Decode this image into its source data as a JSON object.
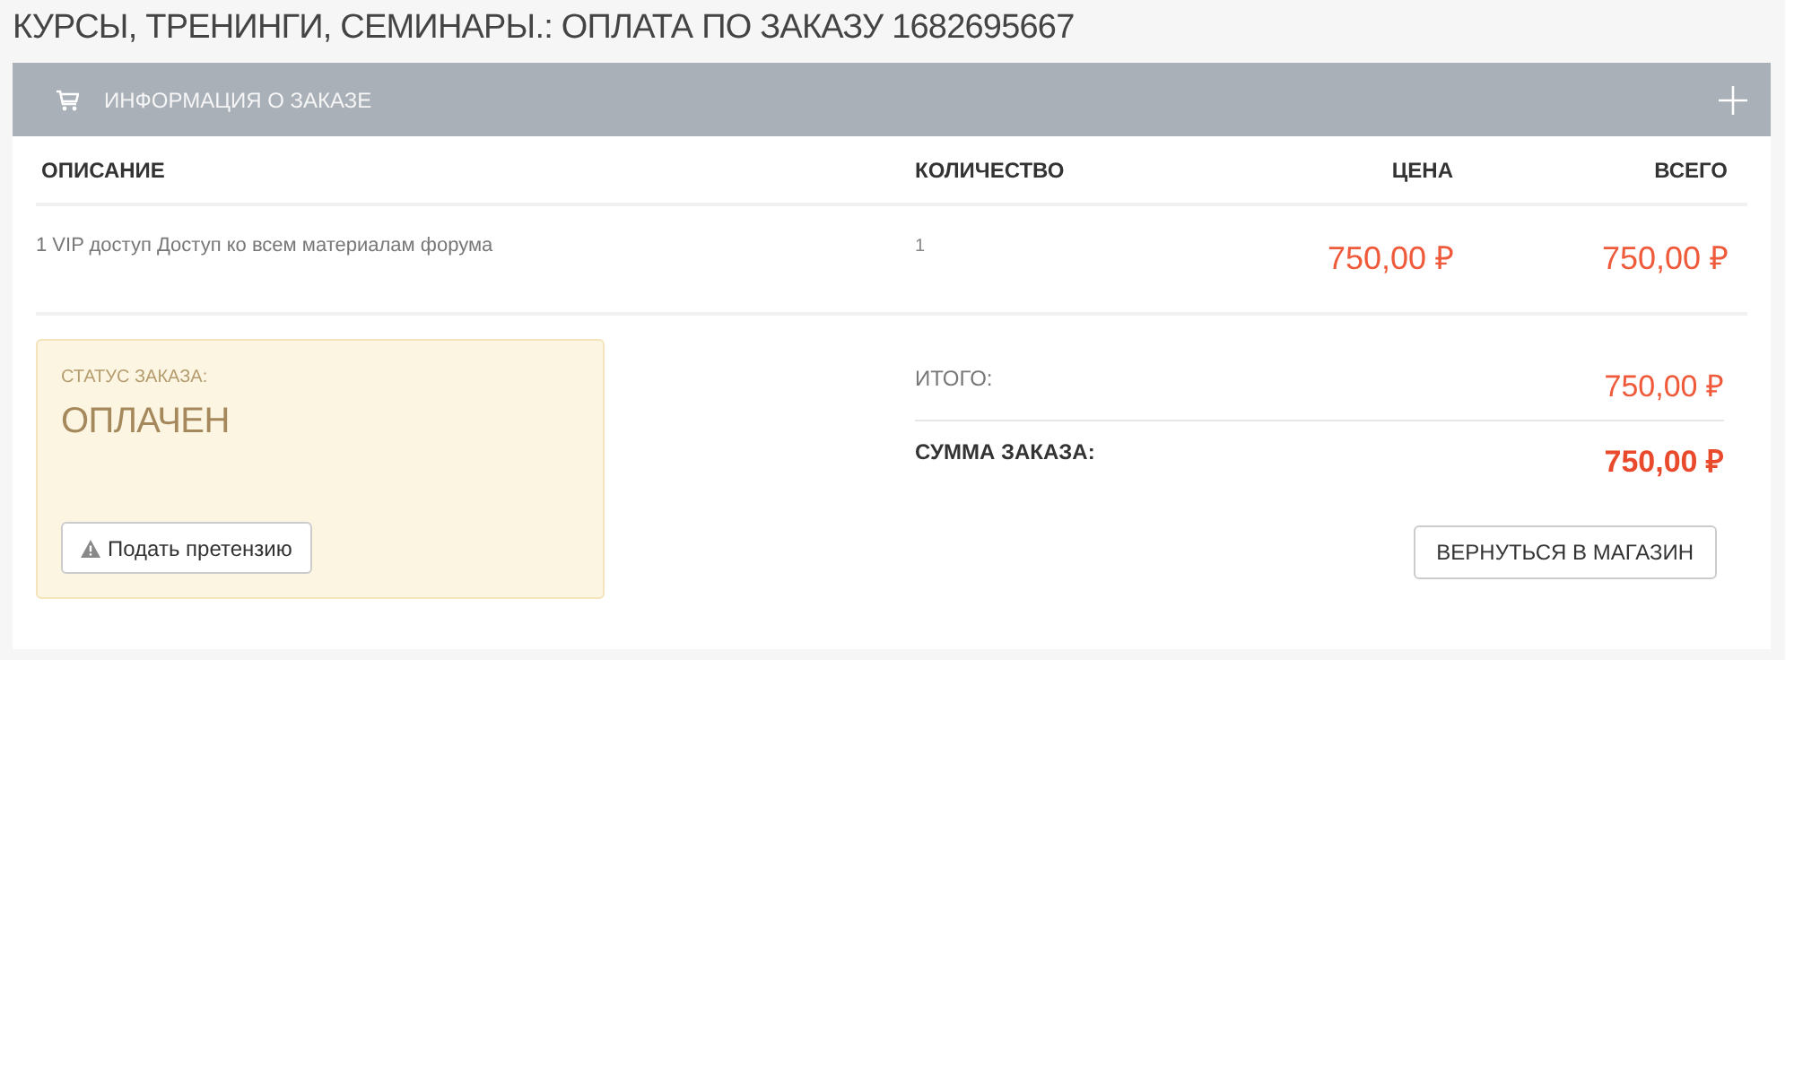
{
  "page_title": "КУРСЫ, ТРЕНИНГИ, СЕМИНАРЫ.: ОПЛАТА ПО ЗАКАЗУ 1682695667",
  "panel": {
    "title": "ИНФОРМАЦИЯ О ЗАКАЗЕ"
  },
  "table": {
    "columns": [
      "ОПИСАНИЕ",
      "КОЛИЧЕСТВО",
      "ЦЕНА",
      "ВСЕГО"
    ],
    "rows": [
      {
        "description": "1 VIP доступ Доступ ко всем материалам форума",
        "quantity": "1",
        "price": "750,00 ₽",
        "total": "750,00 ₽"
      }
    ]
  },
  "status": {
    "label": "СТАТУС ЗАКАЗА:",
    "value": "ОПЛАЧЕН",
    "button": "Подать претензию"
  },
  "totals": [
    {
      "kind": "subtotal",
      "label": "ИТОГО:",
      "value": "750,00 ₽"
    },
    {
      "kind": "grand",
      "label": "СУММА ЗАКАЗА:",
      "value": "750,00 ₽"
    }
  ],
  "back_button": "ВЕРНУТЬСЯ В МАГАЗИН"
}
